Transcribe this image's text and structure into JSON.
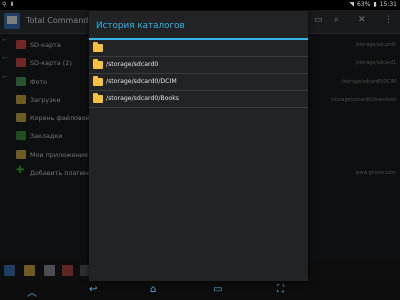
{
  "status_bar": {
    "battery": "63%",
    "time": "15:31"
  },
  "app": {
    "title": "Total Commander"
  },
  "left_panel": {
    "items": [
      {
        "label": "SD-карта",
        "icon": "sdcard-icon",
        "color": "#d04848"
      },
      {
        "label": "SD-карта (2)",
        "icon": "sdcard-icon",
        "color": "#d04848"
      },
      {
        "label": "Фото",
        "icon": "photo-icon",
        "color": "#4a9a5c"
      },
      {
        "label": "Загрузки",
        "icon": "folder-icon",
        "color": "#c9a441"
      },
      {
        "label": "Корень файловой си",
        "icon": "folder-icon",
        "color": "#c9a441"
      },
      {
        "label": "Закладки",
        "icon": "bookmarks-icon",
        "color": "#3c8f3c"
      },
      {
        "label": "Мои приложения",
        "icon": "apps-icon",
        "color": "#c9a441"
      },
      {
        "label": "Добавить плагины (",
        "icon": "plus-icon",
        "color": "#2fb52f"
      }
    ]
  },
  "right_panel": {
    "paths": [
      "/storage/sdcard0",
      "/storage/sdcard1",
      "/storage/sdcard0/DCIM",
      "/storage/sdcard0/download",
      "",
      "",
      "",
      "www.ghisler.com"
    ]
  },
  "dialog": {
    "title": "История каталогов",
    "rows": [
      {
        "path": ""
      },
      {
        "path": "/storage/sdcard0"
      },
      {
        "path": "/storage/sdcard0/DCIM"
      },
      {
        "path": "/storage/sdcard0/Books"
      }
    ]
  },
  "colors": {
    "accent": "#34b5e5",
    "folder": "#f6c23f"
  }
}
